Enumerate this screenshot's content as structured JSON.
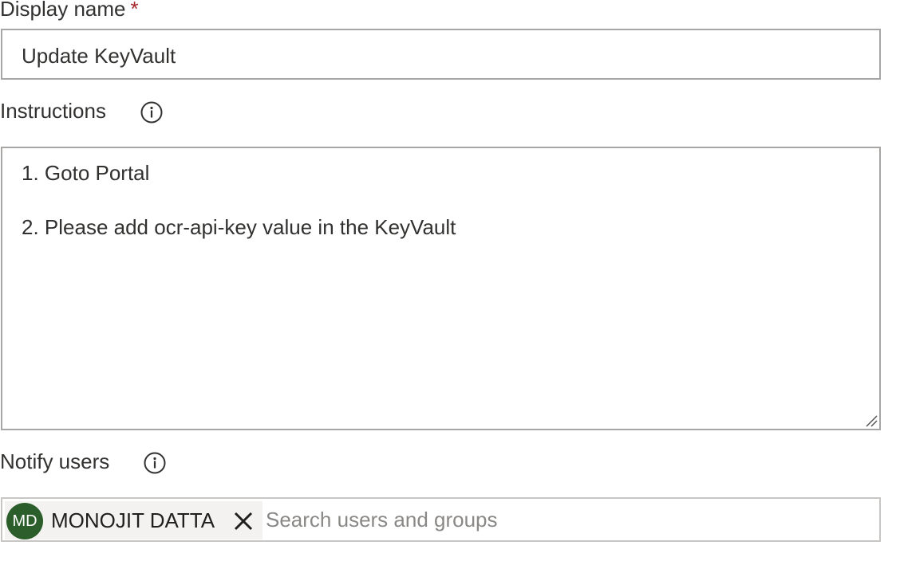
{
  "display_name": {
    "label": "Display name",
    "required_mark": "*",
    "value": "Update KeyVault"
  },
  "instructions": {
    "label": "Instructions",
    "info_icon": "info-icon",
    "lines": [
      "1. Goto Portal",
      "2. Please add ocr-api-key value in the KeyVault"
    ]
  },
  "notify_users": {
    "label": "Notify users",
    "info_icon": "info-icon",
    "selected_user": {
      "initials": "MD",
      "name": "MONOJIT DATTA",
      "avatar_color": "#2b5e2b"
    },
    "remove_icon": "close-icon",
    "search_placeholder": "Search users and groups"
  },
  "colors": {
    "required": "#a4262c",
    "border": "#a8a6a4",
    "text": "#323130",
    "placeholder": "#8a8886",
    "persona_bg": "#f3f2f1"
  }
}
